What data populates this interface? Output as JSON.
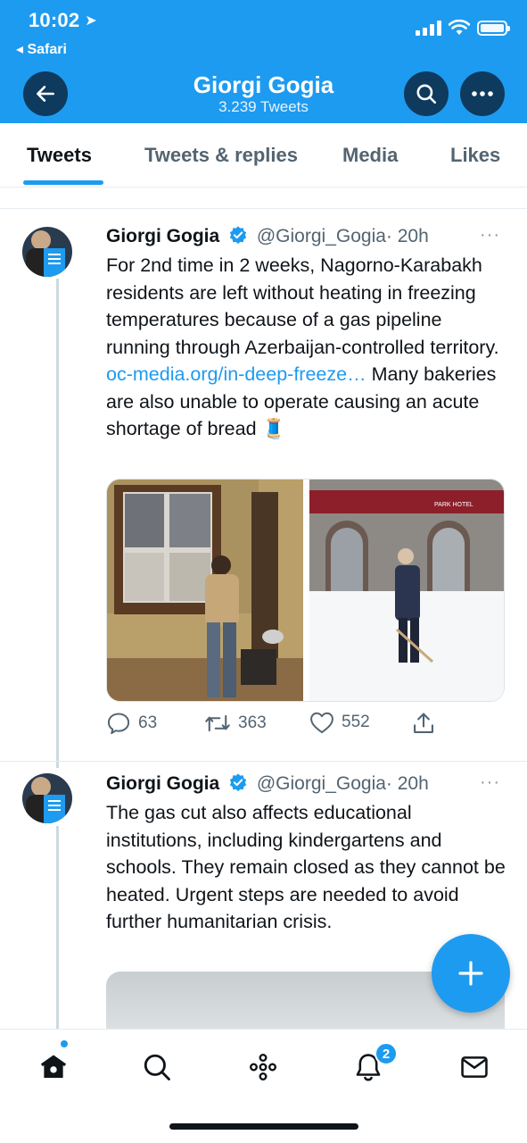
{
  "status_bar": {
    "time": "10:02",
    "back_app": "Safari"
  },
  "header": {
    "title": "Giorgi Gogia",
    "subtitle": "3.239 Tweets"
  },
  "tabs": [
    {
      "label": "Tweets",
      "active": true
    },
    {
      "label": "Tweets & replies",
      "active": false
    },
    {
      "label": "Media",
      "active": false
    },
    {
      "label": "Likes",
      "active": false
    }
  ],
  "tweets": [
    {
      "name": "Giorgi Gogia",
      "handle": "@Giorgi_Gogia",
      "time": "· 20h",
      "text_before_link": "For 2nd time in 2 weeks, Nagorno-Karabakh residents are left without heating in freezing temperatures because of a gas pipeline running through Azerbaijan-controlled territory. ",
      "link": "oc-media.org/in-deep-freeze…",
      "text_after_link": " Many bakeries are also unable to operate causing an acute shortage of bread 🧵",
      "replies": "63",
      "retweets": "363",
      "likes": "552",
      "photo_sign_text": "PARK HOTEL"
    },
    {
      "name": "Giorgi Gogia",
      "handle": "@Giorgi_Gogia",
      "time": "· 20h",
      "text": "The gas cut also affects educational institutions, including kindergartens and schools. They remain closed as they cannot be heated. Urgent steps are needed to avoid further humanitarian crisis."
    }
  ],
  "avatar_text": "HUMAN RIGHTS WATCH",
  "bottom_nav": {
    "notifications_badge": "2"
  },
  "colors": {
    "brand": "#1d9bf0",
    "header_button": "#0e3a5e",
    "text": "#0f1419",
    "muted": "#536471"
  },
  "icons": [
    "back-arrow-icon",
    "search-icon",
    "more-icon",
    "verified-icon",
    "reply-icon",
    "retweet-icon",
    "like-icon",
    "share-icon",
    "compose-plus-icon",
    "home-icon",
    "spaces-icon",
    "bell-icon",
    "mail-icon"
  ]
}
